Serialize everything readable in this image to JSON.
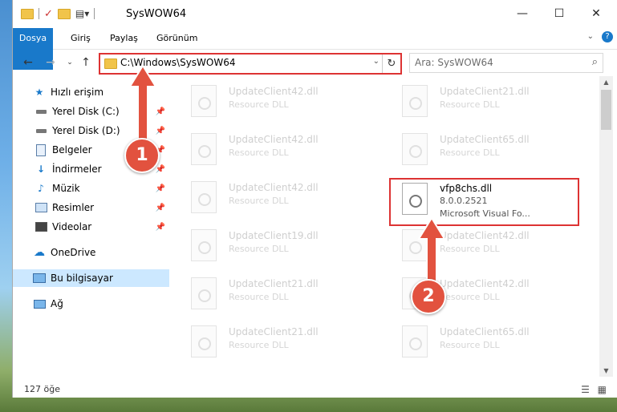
{
  "window": {
    "title": "SysWOW64"
  },
  "title_buttons": {
    "minimize": "—",
    "maximize": "☐",
    "close": "✕"
  },
  "ribbon": {
    "tabs": [
      "Dosya",
      "Giriş",
      "Paylaş",
      "Görünüm"
    ],
    "help": "?"
  },
  "address": {
    "path": "C:\\Windows\\SysWOW64"
  },
  "search": {
    "placeholder": "Ara: SysWOW64"
  },
  "nav": {
    "items": [
      {
        "label": "Hızlı erişim",
        "icon": "star-icon"
      },
      {
        "label": "Yerel Disk (C:)",
        "icon": "drive-icon"
      },
      {
        "label": "Yerel Disk (D:)",
        "icon": "drive-icon"
      },
      {
        "label": "Belgeler",
        "icon": "documents-icon"
      },
      {
        "label": "İndirmeler",
        "icon": "download-icon"
      },
      {
        "label": "Müzik",
        "icon": "music-icon"
      },
      {
        "label": "Resimler",
        "icon": "pictures-icon"
      },
      {
        "label": "Videolar",
        "icon": "videos-icon"
      },
      {
        "label": "OneDrive",
        "icon": "cloud-icon"
      },
      {
        "label": "Bu bilgisayar",
        "icon": "computer-icon"
      },
      {
        "label": "Ağ",
        "icon": "network-icon"
      }
    ]
  },
  "files": {
    "left": [
      {
        "name": "UpdateClient42.dll",
        "desc": "Resource DLL"
      },
      {
        "name": "UpdateClient42.dll",
        "desc": "Resource DLL"
      },
      {
        "name": "UpdateClient42.dll",
        "desc": "Resource DLL"
      },
      {
        "name": "UpdateClient19.dll",
        "desc": "Resource DLL"
      },
      {
        "name": "UpdateClient21.dll",
        "desc": "Resource DLL"
      },
      {
        "name": "UpdateClient21.dll",
        "desc": "Resource DLL"
      }
    ],
    "right": [
      {
        "name": "UpdateClient21.dll",
        "desc": "Resource DLL"
      },
      {
        "name": "UpdateClient65.dll",
        "desc": "Resource DLL"
      },
      {
        "name": "UpdateClient42.dll",
        "desc": "Resource DLL"
      },
      {
        "name": "UpdateClient42.dll",
        "desc": "Resource DLL"
      },
      {
        "name": "UpdateClient65.dll",
        "desc": "Resource DLL"
      }
    ],
    "active": {
      "name": "vfp8chs.dll",
      "version": "8.0.0.2521",
      "desc": "Microsoft Visual Fo..."
    }
  },
  "status": {
    "count": "127 öğe"
  },
  "badges": {
    "one": "1",
    "two": "2"
  },
  "colors": {
    "accent": "#1979ca",
    "highlight": "#dd3333",
    "badge": "#e2523f"
  }
}
